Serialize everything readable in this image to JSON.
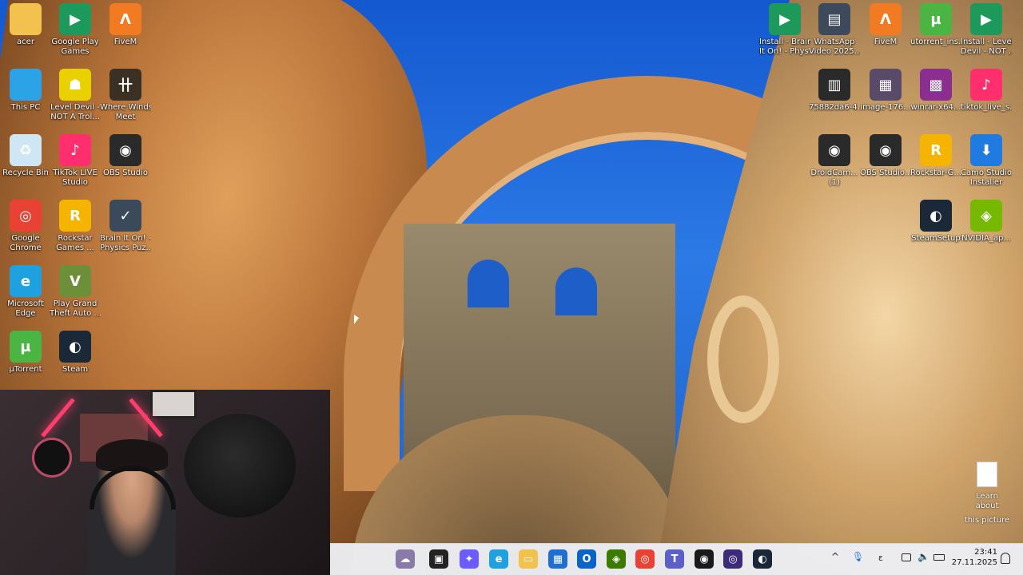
{
  "desktop_icons_left": [
    {
      "name": "folder-icon",
      "label": "acer",
      "label2": "",
      "color": "#f2c14e",
      "glyph": ""
    },
    {
      "name": "google-play-games-icon",
      "label": "Google Play",
      "label2": "Games",
      "color": "#1d9a5b",
      "glyph": "▶"
    },
    {
      "name": "fivem-icon",
      "label": "FiveM",
      "label2": "",
      "color": "#f07b22",
      "glyph": "Λ"
    },
    {
      "name": "this-pc-icon",
      "label": "This PC",
      "label2": "",
      "color": "#2ba3e6",
      "glyph": ""
    },
    {
      "name": "level-devil-icon",
      "label": "Level Devil -",
      "label2": "NOT A Trol...",
      "color": "#e9d100",
      "glyph": "☗"
    },
    {
      "name": "where-winds-meet-icon",
      "label": "Where Winds",
      "label2": "Meet",
      "color": "#3b3024",
      "glyph": "卄"
    },
    {
      "name": "recycle-bin-icon",
      "label": "Recycle Bin",
      "label2": "",
      "color": "#cfe6f5",
      "glyph": "♻"
    },
    {
      "name": "tiktok-live-studio-icon",
      "label": "TikTok LIVE",
      "label2": "Studio",
      "color": "#ff2f6e",
      "glyph": "♪"
    },
    {
      "name": "obs-studio-icon",
      "label": "OBS Studio",
      "label2": "",
      "color": "#2a2a2a",
      "glyph": "◉"
    },
    {
      "name": "google-chrome-icon",
      "label": "Google",
      "label2": "Chrome",
      "color": "#e94235",
      "glyph": "◎"
    },
    {
      "name": "rockstar-games-icon",
      "label": "Rockstar",
      "label2": "Games ...",
      "color": "#f5b400",
      "glyph": "R"
    },
    {
      "name": "brain-it-on-icon",
      "label": "Brain It On! -",
      "label2": "Physics Puz...",
      "color": "#3b4a5a",
      "glyph": "✓"
    },
    {
      "name": "microsoft-edge-icon",
      "label": "Microsoft",
      "label2": "Edge",
      "color": "#1fa1e0",
      "glyph": "e"
    },
    {
      "name": "gta-v-icon",
      "label": "Play Grand",
      "label2": "Theft Auto ...",
      "color": "#6d8f3a",
      "glyph": "V"
    },
    {
      "name": "utorrent-icon",
      "label": "µTorrent",
      "label2": "",
      "color": "#4bb543",
      "glyph": "µ"
    },
    {
      "name": "steam-icon",
      "label": "Steam",
      "label2": "",
      "color": "#1b2838",
      "glyph": "◐"
    }
  ],
  "desktop_icons_right": [
    {
      "name": "brain-it-on-installer-icon",
      "label": "Install - Brain",
      "label2": "It On! - Phys...",
      "color": "#1d9a5b",
      "glyph": "▶"
    },
    {
      "name": "whatsapp-video-icon",
      "label": "WhatsApp",
      "label2": "Video 2025...",
      "color": "#3c4a5c",
      "glyph": "▤"
    },
    {
      "name": "fivem-icon-2",
      "label": "FiveM",
      "label2": "",
      "color": "#f07b22",
      "glyph": "Λ"
    },
    {
      "name": "utorrent-installer-icon",
      "label": "utorrent_ins...",
      "label2": "",
      "color": "#4bb543",
      "glyph": "µ"
    },
    {
      "name": "level-devil-installer-icon",
      "label": "Install - Level",
      "label2": "Devil - NOT ...",
      "color": "#1d9a5b",
      "glyph": "▶"
    },
    {
      "name": "image-file-icon",
      "label": "75882da6-4...",
      "label2": "",
      "color": "#2a2a2a",
      "glyph": "▥"
    },
    {
      "name": "image-176-icon",
      "label": "image-176...",
      "label2": "",
      "color": "#5a4a6a",
      "glyph": "▦"
    },
    {
      "name": "winrar-icon",
      "label": "winrar-x64...",
      "label2": "",
      "color": "#8a2f8f",
      "glyph": "▩"
    },
    {
      "name": "tiktok-live-setup-icon",
      "label": "tiktok_live_s...",
      "label2": "",
      "color": "#ff2f6e",
      "glyph": "♪"
    },
    {
      "name": "droidcam-icon",
      "label": "DroidCam...",
      "label2": "(1)",
      "color": "#2a2a2a",
      "glyph": "◉"
    },
    {
      "name": "obs-studio-installer-icon",
      "label": "OBS Studio...",
      "label2": "",
      "color": "#2a2a2a",
      "glyph": "◉"
    },
    {
      "name": "rockstar-installer-icon",
      "label": "Rockstar-G...",
      "label2": "",
      "color": "#f5b400",
      "glyph": "R"
    },
    {
      "name": "camo-studio-installer-icon",
      "label": "Camo Studio",
      "label2": "Installer",
      "color": "#1f7be0",
      "glyph": "⬇"
    },
    {
      "name": "steam-setup-icon",
      "label": "SteamSetup",
      "label2": "",
      "color": "#1b2838",
      "glyph": "◐"
    },
    {
      "name": "nvidia-app-icon",
      "label": "NVIDIA_ap...",
      "label2": "",
      "color": "#76b900",
      "glyph": "◈"
    }
  ],
  "learn_about": {
    "label": "Learn about",
    "label2": "this picture"
  },
  "taskbar": {
    "apps": [
      {
        "name": "widgets-icon",
        "color": "#8a7aa8",
        "glyph": "☁"
      },
      {
        "name": "task-view-icon",
        "color": "#222222",
        "glyph": "▣"
      },
      {
        "name": "copilot-icon",
        "color": "#6a5cff",
        "glyph": "✦"
      },
      {
        "name": "edge-taskbar-icon",
        "color": "#1fa1e0",
        "glyph": "e"
      },
      {
        "name": "file-explorer-icon",
        "color": "#f2c14e",
        "glyph": "▭"
      },
      {
        "name": "microsoft-store-icon",
        "color": "#1f6fd1",
        "glyph": "▦"
      },
      {
        "name": "outlook-icon",
        "color": "#0a64c8",
        "glyph": "O"
      },
      {
        "name": "nvidia-taskbar-icon",
        "color": "#3c7a00",
        "glyph": "◈"
      },
      {
        "name": "chrome-taskbar-icon",
        "color": "#e94235",
        "glyph": "◎"
      },
      {
        "name": "teams-icon",
        "color": "#5b5fc7",
        "glyph": "T"
      },
      {
        "name": "obs-taskbar-icon",
        "color": "#1a1a1a",
        "glyph": "◉"
      },
      {
        "name": "obs-alt-taskbar-icon",
        "color": "#3c2a7a",
        "glyph": "◎"
      },
      {
        "name": "steam-taskbar-icon",
        "color": "#1b2838",
        "glyph": "◐"
      }
    ],
    "tray": {
      "chevron": "^",
      "mic": "🎙",
      "lang": "ε"
    },
    "time": "23:41",
    "date": "27.11.2025"
  }
}
